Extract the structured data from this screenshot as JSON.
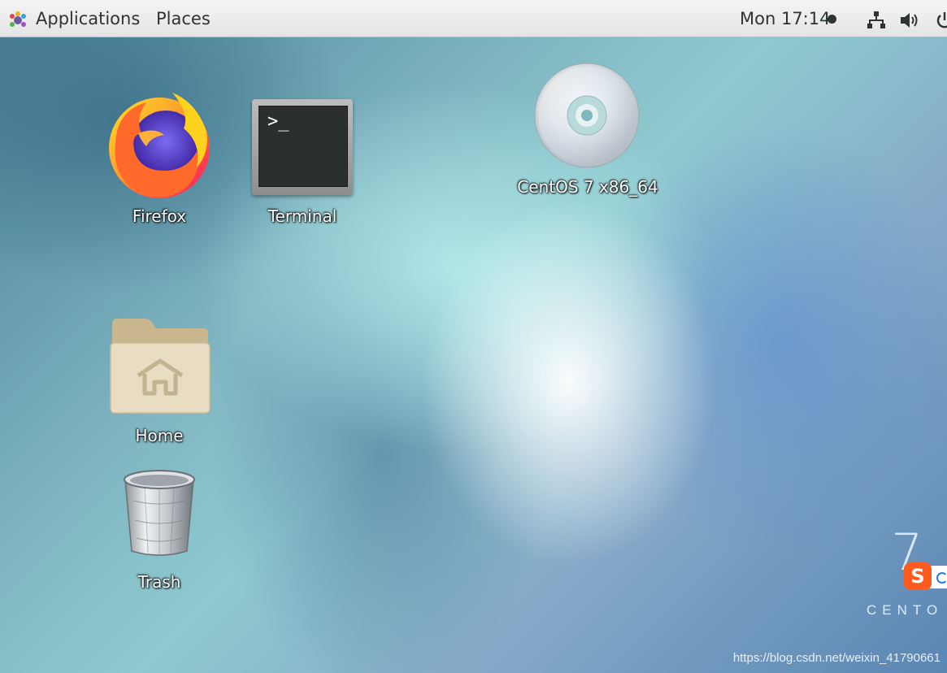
{
  "topbar": {
    "applications_label": "Applications",
    "places_label": "Places",
    "clock": "Mon 17:14",
    "icons": [
      "gnome-foot-icon",
      "network-icon",
      "volume-icon",
      "power-icon"
    ]
  },
  "desktop": {
    "firefox": {
      "label": "Firefox",
      "icon": "firefox-icon"
    },
    "terminal": {
      "label": "Terminal",
      "icon": "terminal-icon",
      "prompt": ">_"
    },
    "disc": {
      "label": "CentOS 7 x86_64",
      "icon": "optical-disc-icon"
    },
    "home": {
      "label": "Home",
      "icon": "home-folder-icon"
    },
    "trash": {
      "label": "Trash",
      "icon": "trash-icon"
    }
  },
  "branding": {
    "version_numeral": "7",
    "wordmark": "CENTO",
    "ime_badge": "S"
  },
  "watermark": "https://blog.csdn.net/weixin_41790661",
  "colors": {
    "topbar": "#ececec",
    "firefox_orange": "#ff7139",
    "firefox_blue": "#4a2fb8",
    "terminal_screen": "#2b302c",
    "folder": "#e6d8bd",
    "ime_red": "#ff5a1f"
  }
}
